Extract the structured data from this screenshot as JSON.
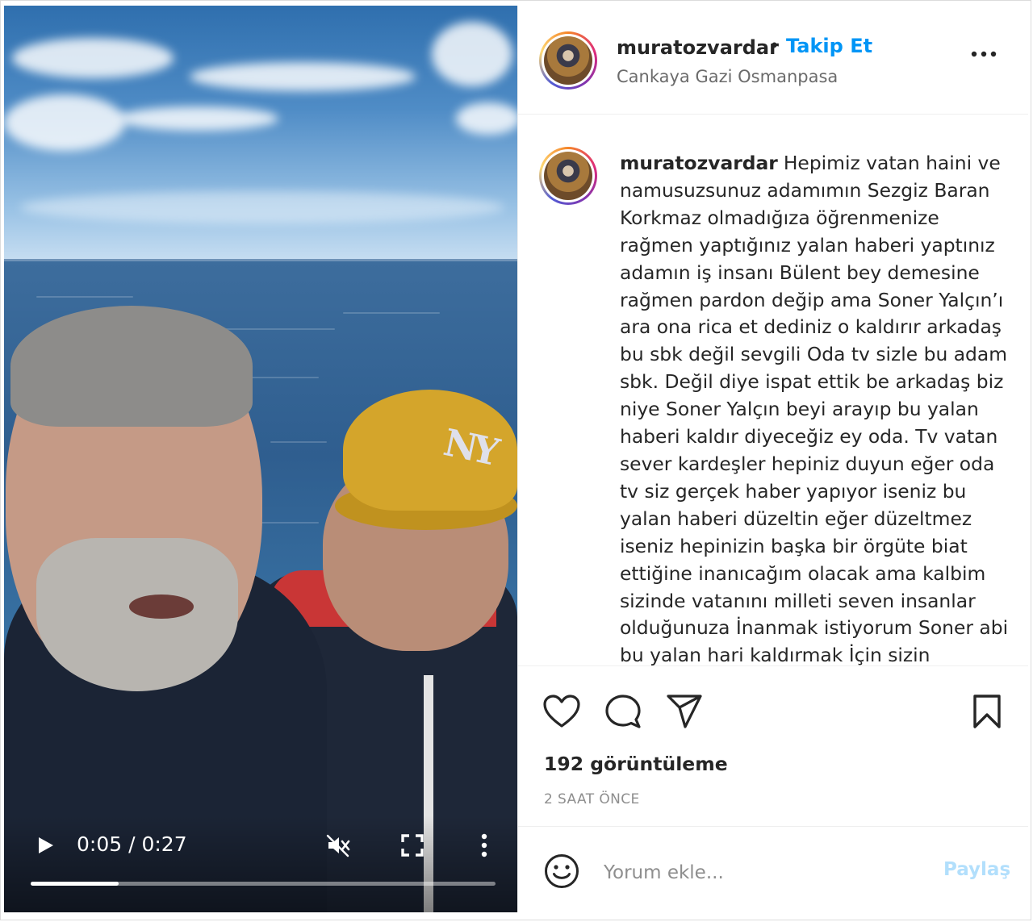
{
  "post": {
    "username": "muratozvardar",
    "separator": "•",
    "follow_label": "Takip Et",
    "location": "Cankaya Gazi Osmanpasa",
    "more_icon": "more-horizontal-icon"
  },
  "caption": {
    "username": "muratozvardar",
    "text": "Hepimiz vatan haini ve namusuzsunuz adamımın Sezgiz Baran Korkmaz olmadığıza öğrenmenize rağmen yaptığınız yalan haberi yaptınız adamın iş insanı Bülent bey demesine rağmen pardon değip ama Soner Yalçın’ı ara ona rica et dediniz o kaldırır arkadaş bu sbk değil sevgili Oda tv sizle bu adam sbk. Değil diye ispat ettik be arkadaş biz niye Soner Yalçın beyi arayıp bu yalan haberi kaldır diyeceğiz ey oda. Tv vatan sever kardeşler hepiniz duyun eğer oda tv siz gerçek haber yapıyor iseniz bu yalan haberi düzeltin eğer düzeltmez iseniz hepinizin başka bir örgüte biat ettiğine inanıcağım olacak ama kalbim sizinde vatanını milleti seven insanlar olduğunuza İnanmak istiyorum Soner abi bu yalan hari kaldırmak İçin sizin"
  },
  "video": {
    "current_time": "0:05",
    "duration": "0:27",
    "time_display": "0:05 / 0:27",
    "progress": 0.19,
    "muted": true,
    "icons": [
      "play-icon",
      "muted-icon",
      "fullscreen-icon",
      "more-vertical-icon"
    ]
  },
  "actions": {
    "icons": [
      "heart-icon",
      "comment-icon",
      "share-icon",
      "bookmark-icon"
    ],
    "views": "192 görüntüleme",
    "time_ago": "2 SAAT ÖNCE"
  },
  "comment": {
    "placeholder": "Yorum ekle...",
    "share_label": "Paylaş",
    "emoji_icon": "emoji-icon"
  },
  "colors": {
    "accent": "#0095f6",
    "share_disabled": "#b2dffc",
    "text": "#262626",
    "muted_text": "#8e8e8e"
  }
}
